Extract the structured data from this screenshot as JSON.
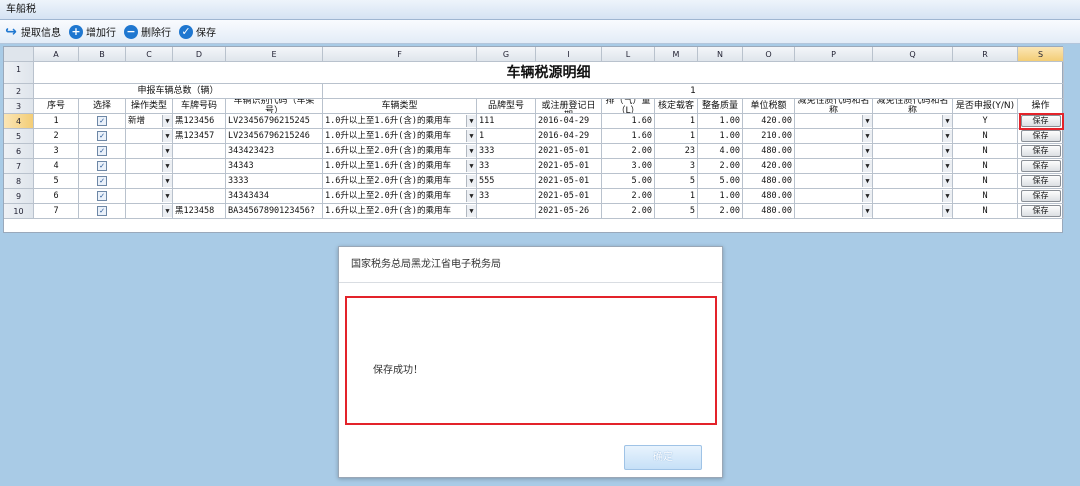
{
  "window": {
    "title": "车船税"
  },
  "toolbar": [
    {
      "name": "extract-info-button",
      "icon": "arrow-icon",
      "label": "提取信息"
    },
    {
      "name": "add-row-button",
      "icon": "plus-circle-icon",
      "label": "增加行"
    },
    {
      "name": "delete-row-button",
      "icon": "minus-circle-icon",
      "label": "删除行"
    },
    {
      "name": "save-toolbar-button",
      "icon": "check-circle-icon",
      "label": "保存"
    }
  ],
  "sheet": {
    "columns": [
      "A",
      "B",
      "C",
      "D",
      "E",
      "F",
      "G",
      "I",
      "L",
      "M",
      "N",
      "O",
      "P",
      "Q",
      "R",
      "S"
    ],
    "row_numbers": [
      "1",
      "2",
      "3",
      "4",
      "5",
      "6",
      "7",
      "8",
      "9",
      "10"
    ],
    "title": "车辆税源明细",
    "total_label": "申报车辆总数（辆）",
    "total_value": "1",
    "headers": [
      "序号",
      "选择",
      "操作类型",
      "车牌号码",
      "车辆识别代码（车架号）",
      "车辆类型",
      "品牌型号",
      "车辆发票日期或注册登记日期",
      "排（气）量（L）",
      "核定载客",
      "整备质量",
      "单位税额",
      "减免性质代码和名称",
      "减免性质代码和名称",
      "是否申报(Y/N)",
      "操作"
    ],
    "rows": [
      {
        "seq": "1",
        "op": "新增",
        "plate": "黑123456",
        "vin": "LV23456796215245",
        "type": "1.0升以上至1.6升(含)的乘用车",
        "brand": "111",
        "date": "2016-04-29",
        "disp": "1.60",
        "seats": "1",
        "mass": "1.00",
        "tax": "420.00",
        "yn": "Y",
        "btn": "保存"
      },
      {
        "seq": "2",
        "op": "",
        "plate": "黑123457",
        "vin": "LV23456796215246",
        "type": "1.0升以上至1.6升(含)的乘用车",
        "brand": "1",
        "date": "2016-04-29",
        "disp": "1.60",
        "seats": "1",
        "mass": "1.00",
        "tax": "210.00",
        "yn": "N",
        "btn": "保存"
      },
      {
        "seq": "3",
        "op": "",
        "plate": "",
        "vin": "343423423",
        "type": "1.6升以上至2.0升(含)的乘用车",
        "brand": "333",
        "date": "2021-05-01",
        "disp": "2.00",
        "seats": "23",
        "mass": "4.00",
        "tax": "480.00",
        "yn": "N",
        "btn": "保存"
      },
      {
        "seq": "4",
        "op": "",
        "plate": "",
        "vin": "34343",
        "type": "1.0升以上至1.6升(含)的乘用车",
        "brand": "33",
        "date": "2021-05-01",
        "disp": "3.00",
        "seats": "3",
        "mass": "2.00",
        "tax": "420.00",
        "yn": "N",
        "btn": "保存"
      },
      {
        "seq": "5",
        "op": "",
        "plate": "",
        "vin": "3333",
        "type": "1.6升以上至2.0升(含)的乘用车",
        "brand": "555",
        "date": "2021-05-01",
        "disp": "5.00",
        "seats": "5",
        "mass": "5.00",
        "tax": "480.00",
        "yn": "N",
        "btn": "保存"
      },
      {
        "seq": "6",
        "op": "",
        "plate": "",
        "vin": "34343434",
        "type": "1.6升以上至2.0升(含)的乘用车",
        "brand": "33",
        "date": "2021-05-01",
        "disp": "2.00",
        "seats": "1",
        "mass": "1.00",
        "tax": "480.00",
        "yn": "N",
        "btn": "保存"
      },
      {
        "seq": "7",
        "op": "",
        "plate": "黑123458",
        "vin": "BA34567890123456?",
        "type": "1.6升以上至2.0升(含)的乘用车",
        "brand": "",
        "date": "2021-05-26",
        "disp": "2.00",
        "seats": "5",
        "mass": "2.00",
        "tax": "480.00",
        "yn": "N",
        "btn": "保存"
      }
    ]
  },
  "dialog": {
    "title": "国家税务总局黑龙江省电子税务局",
    "message": "保存成功！",
    "ok_label": "确定"
  },
  "colors": {
    "highlight": "#e3232a",
    "accent": "#1f77d0"
  }
}
